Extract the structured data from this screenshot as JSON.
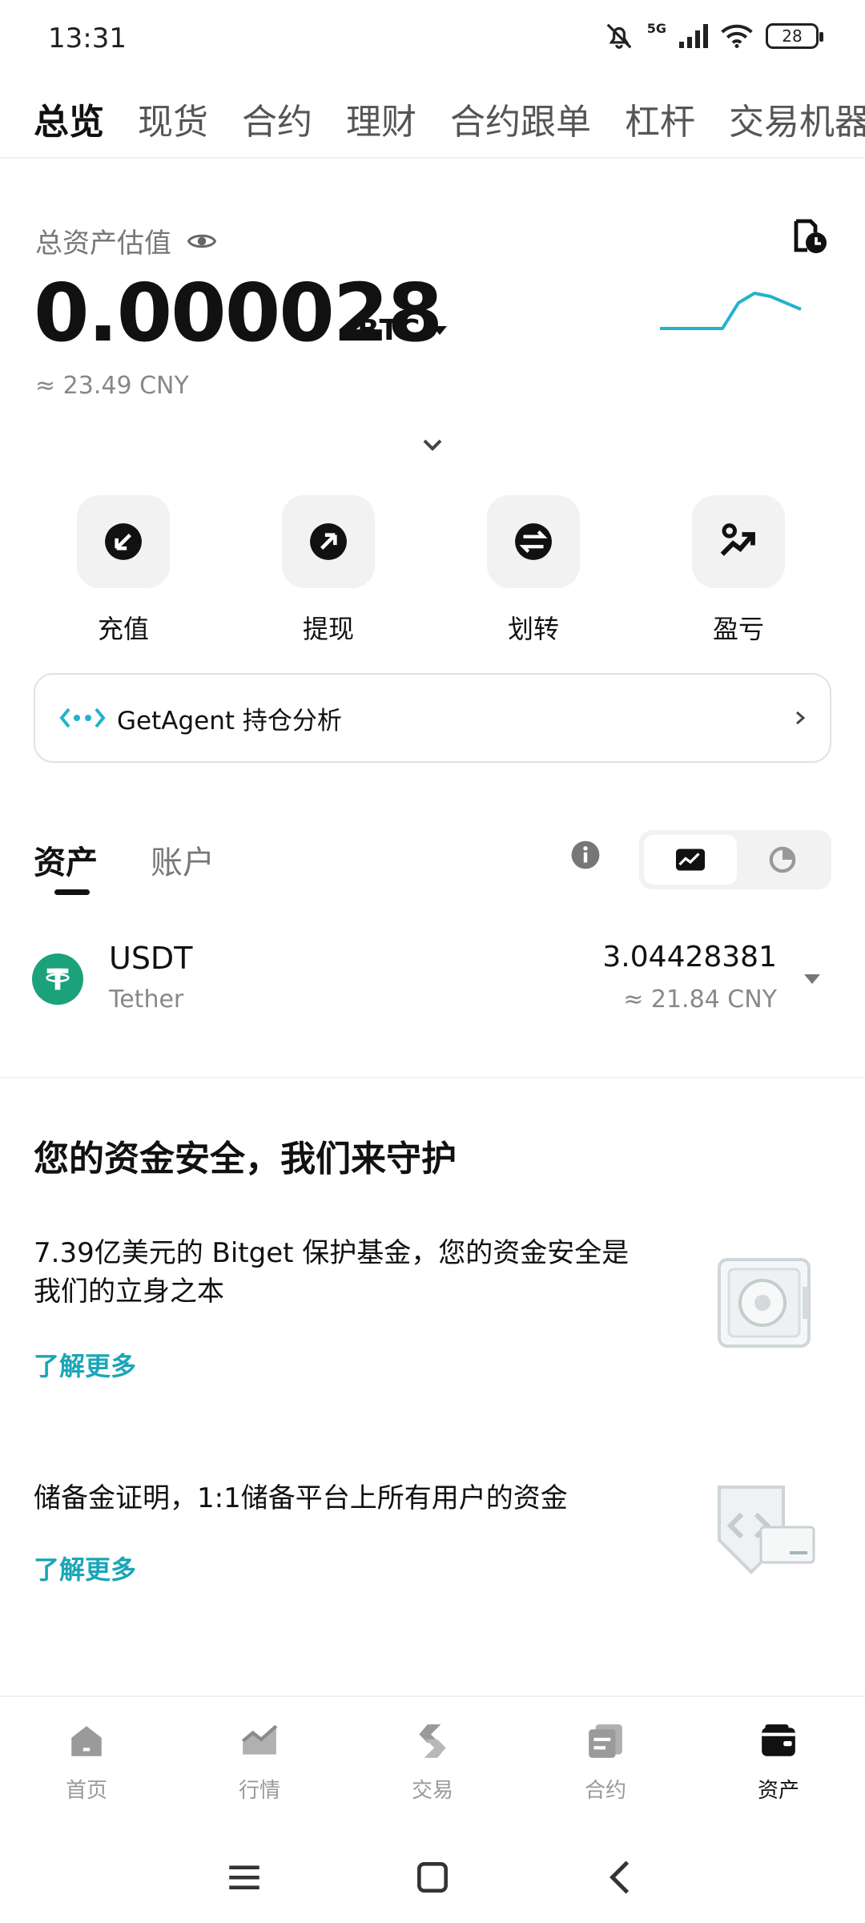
{
  "status_bar": {
    "time": "13:31",
    "network": "5G",
    "battery": "28"
  },
  "tabs": [
    "总览",
    "现货",
    "合约",
    "理财",
    "合约跟单",
    "杠杆",
    "交易机器"
  ],
  "overview": {
    "total_label": "总资产估值",
    "value": "0.000028",
    "unit": "BTC",
    "approx": "≈ 23.49 CNY"
  },
  "actions": [
    {
      "label": "充值",
      "icon": "deposit-icon"
    },
    {
      "label": "提现",
      "icon": "withdraw-icon"
    },
    {
      "label": "划转",
      "icon": "transfer-icon"
    },
    {
      "label": "盈亏",
      "icon": "pnl-icon"
    }
  ],
  "agent_card": {
    "text": "GetAgent 持仓分析"
  },
  "asset_tabs": {
    "assets": "资产",
    "accounts": "账户"
  },
  "assets": [
    {
      "symbol": "USDT",
      "name": "Tether",
      "amount": "3.04428381",
      "cny": "≈ 21.84 CNY"
    }
  ],
  "security": {
    "title": "您的资金安全，我们来守护",
    "fund_text": "7.39亿美元的 Bitget 保护基金，您的资金安全是我们的立身之本",
    "fund_link": "了解更多",
    "reserve_text": "储备金证明，1:1储备平台上所有用户的资金",
    "reserve_link": "了解更多"
  },
  "bottom_nav": [
    "首页",
    "行情",
    "交易",
    "合约",
    "资产"
  ],
  "colors": {
    "accent": "#1aa6b7",
    "usdt": "#1ba27a",
    "sparkline": "#22b3cc"
  }
}
